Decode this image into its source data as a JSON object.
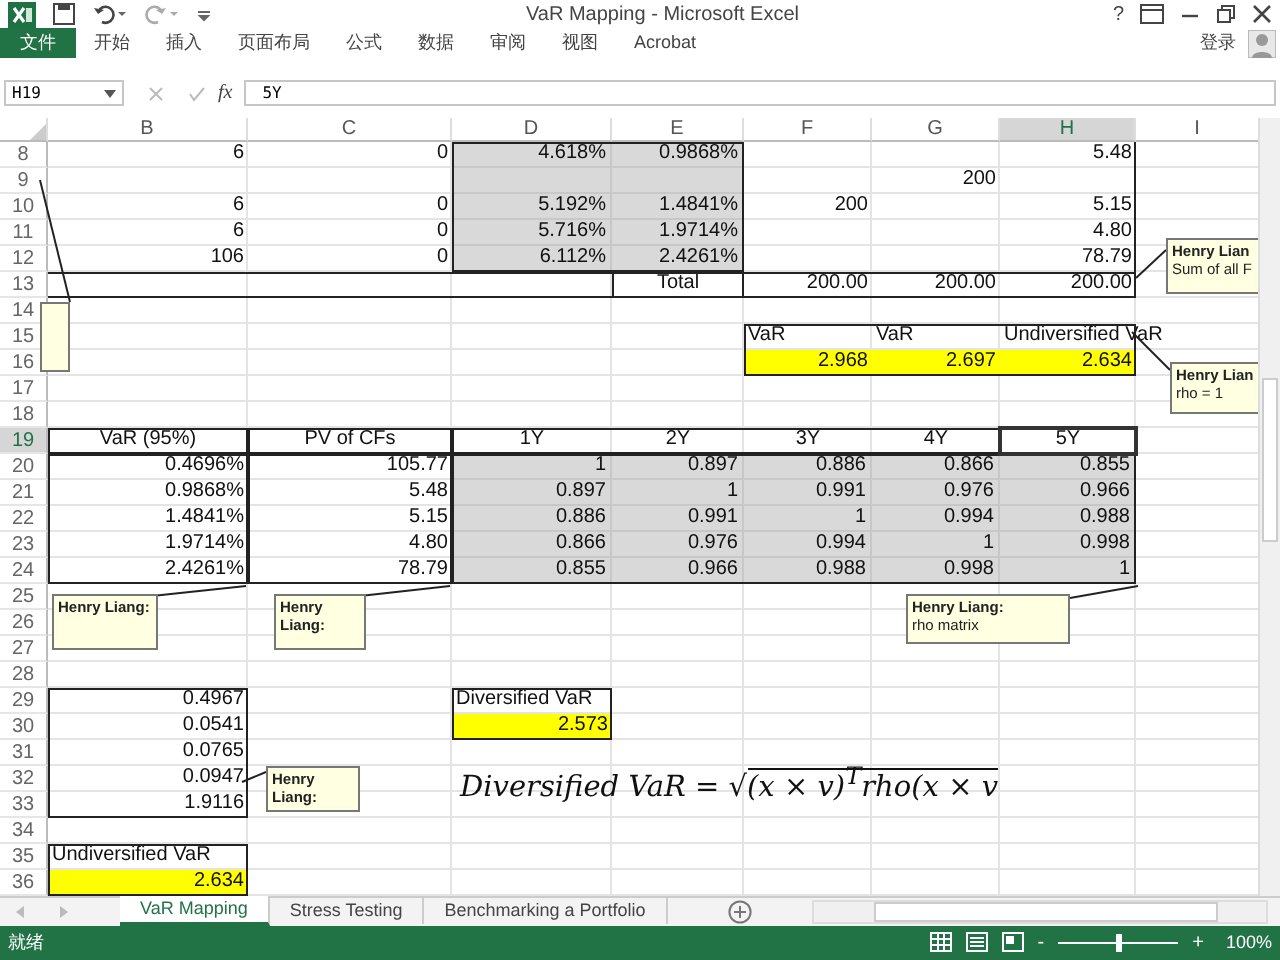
{
  "window": {
    "title": "VaR Mapping - Microsoft Excel",
    "help": "?"
  },
  "ribbon_tabs": [
    {
      "label": "文件",
      "selected": true
    },
    {
      "label": "开始",
      "selected": false
    },
    {
      "label": "插入",
      "selected": false
    },
    {
      "label": "页面布局",
      "selected": false
    },
    {
      "label": "公式",
      "selected": false
    },
    {
      "label": "数据",
      "selected": false
    },
    {
      "label": "审阅",
      "selected": false
    },
    {
      "label": "视图",
      "selected": false
    },
    {
      "label": "Acrobat",
      "selected": false
    }
  ],
  "account": "登录",
  "formula_bar": {
    "name_box": "H19",
    "insert_function": "fx",
    "formula": "5Y"
  },
  "columns": [
    {
      "label": "B",
      "selected": false
    },
    {
      "label": "C",
      "selected": false
    },
    {
      "label": "D",
      "selected": false
    },
    {
      "label": "E",
      "selected": false
    },
    {
      "label": "F",
      "selected": false
    },
    {
      "label": "G",
      "selected": false
    },
    {
      "label": "H",
      "selected": true
    },
    {
      "label": "I",
      "selected": false
    }
  ],
  "rows": [
    {
      "number": "8",
      "selected": false,
      "cells": {
        "B": "6",
        "C": "0",
        "D": "4.618%",
        "E": "0.9868%",
        "H": "5.48"
      }
    },
    {
      "number": "9",
      "selected": false,
      "cells": {
        "G": "200"
      }
    },
    {
      "number": "10",
      "selected": false,
      "cells": {
        "B": "6",
        "C": "0",
        "D": "5.192%",
        "E": "1.4841%",
        "F": "200",
        "H": "5.15"
      }
    },
    {
      "number": "11",
      "selected": false,
      "cells": {
        "B": "6",
        "C": "0",
        "D": "5.716%",
        "E": "1.9714%",
        "H": "4.80"
      }
    },
    {
      "number": "12",
      "selected": false,
      "cells": {
        "B": "106",
        "C": "0",
        "D": "6.112%",
        "E": "2.4261%",
        "H": "78.79"
      }
    },
    {
      "number": "13",
      "selected": false,
      "cells": {
        "E": {
          "text": "Total",
          "kind": "heading"
        },
        "F": "200.00",
        "G": "200.00",
        "H": "200.00"
      }
    },
    {
      "number": "14",
      "selected": false
    },
    {
      "number": "15",
      "selected": false,
      "cells": {
        "F": {
          "text": "VaR",
          "kind": "label"
        },
        "G": {
          "text": "VaR",
          "kind": "label"
        },
        "H": {
          "text": "Undiversified VaR",
          "kind": "label"
        }
      }
    },
    {
      "number": "16",
      "selected": false,
      "cells": {
        "F": "2.968",
        "G": "2.697",
        "H": "2.634"
      }
    },
    {
      "number": "17",
      "selected": false
    },
    {
      "number": "18",
      "selected": false
    },
    {
      "number": "19",
      "selected": true,
      "cells": {
        "B": {
          "text": "VaR (95%)",
          "kind": "heading"
        },
        "C": {
          "text": "PV of CFs",
          "kind": "heading"
        },
        "D": {
          "text": "1Y",
          "kind": "heading"
        },
        "E": {
          "text": "2Y",
          "kind": "heading"
        },
        "F": {
          "text": "3Y",
          "kind": "heading"
        },
        "G": {
          "text": "4Y",
          "kind": "heading"
        },
        "H": {
          "text": "5Y",
          "kind": "heading"
        }
      }
    },
    {
      "number": "20",
      "selected": false,
      "cells": {
        "B": "0.4696%",
        "C": "105.77",
        "D": "1",
        "E": "0.897",
        "F": "0.886",
        "G": "0.866",
        "H": "0.855"
      }
    },
    {
      "number": "21",
      "selected": false,
      "cells": {
        "B": "0.9868%",
        "C": "5.48",
        "D": "0.897",
        "E": "1",
        "F": "0.991",
        "G": "0.976",
        "H": "0.966"
      }
    },
    {
      "number": "22",
      "selected": false,
      "cells": {
        "B": "1.4841%",
        "C": "5.15",
        "D": "0.886",
        "E": "0.991",
        "F": "1",
        "G": "0.994",
        "H": "0.988"
      }
    },
    {
      "number": "23",
      "selected": false,
      "cells": {
        "B": "1.9714%",
        "C": "4.80",
        "D": "0.866",
        "E": "0.976",
        "F": "0.994",
        "G": "1",
        "H": "0.998"
      }
    },
    {
      "number": "24",
      "selected": false,
      "cells": {
        "B": "2.4261%",
        "C": "78.79",
        "D": "0.855",
        "E": "0.966",
        "F": "0.988",
        "G": "0.998",
        "H": "1"
      }
    },
    {
      "number": "25",
      "selected": false
    },
    {
      "number": "26",
      "selected": false
    },
    {
      "number": "27",
      "selected": false
    },
    {
      "number": "28",
      "selected": false
    },
    {
      "number": "29",
      "selected": false,
      "cells": {
        "B": "0.4967",
        "D": {
          "text": "Diversified VaR",
          "kind": "label"
        }
      }
    },
    {
      "number": "30",
      "selected": false,
      "cells": {
        "B": "0.0541",
        "D": "2.573"
      }
    },
    {
      "number": "31",
      "selected": false,
      "cells": {
        "B": "0.0765"
      }
    },
    {
      "number": "32",
      "selected": false,
      "cells": {
        "B": "0.0947"
      }
    },
    {
      "number": "33",
      "selected": false,
      "cells": {
        "B": "1.9116"
      }
    },
    {
      "number": "34",
      "selected": false
    },
    {
      "number": "35",
      "selected": false,
      "cells": {
        "B": {
          "text": "Undiversified VaR",
          "kind": "label"
        }
      }
    },
    {
      "number": "36",
      "selected": false,
      "cells": {
        "B": "2.634"
      }
    }
  ],
  "comments": [
    {
      "author": "Henry Lian",
      "text": "Sum of all F"
    },
    {
      "author": "Henry Lian",
      "text": "rho = 1"
    },
    {
      "author": "Henry Liang:"
    },
    {
      "author": "Henry Liang:"
    },
    {
      "author": "Henry Liang:",
      "text": "rho matrix"
    },
    {
      "author": "Henry Liang:"
    }
  ],
  "equation": {
    "lhs": "Diversified VaR =",
    "radical": "√",
    "radicand": "(x × v)$^{T}$rho(x × v"
  },
  "sheet_tabs": [
    {
      "label": "VaR Mapping",
      "selected": true
    },
    {
      "label": "Stress Testing",
      "selected": false
    },
    {
      "label": "Benchmarking a Portfolio",
      "selected": false
    }
  ],
  "status_bar": {
    "status": "就绪",
    "zoom_out": "-",
    "zoom_slider": {
      "level": 0.5
    },
    "zoom_in": "+",
    "zoom": "100%"
  }
}
